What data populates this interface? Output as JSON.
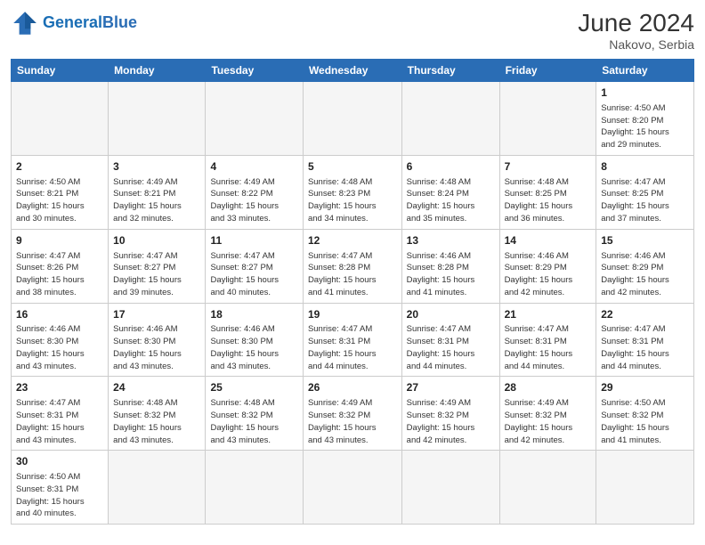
{
  "header": {
    "logo_general": "General",
    "logo_blue": "Blue",
    "month_year": "June 2024",
    "location": "Nakovo, Serbia"
  },
  "weekdays": [
    "Sunday",
    "Monday",
    "Tuesday",
    "Wednesday",
    "Thursday",
    "Friday",
    "Saturday"
  ],
  "weeks": [
    [
      {
        "day": "",
        "empty": true
      },
      {
        "day": "",
        "empty": true
      },
      {
        "day": "",
        "empty": true
      },
      {
        "day": "",
        "empty": true
      },
      {
        "day": "",
        "empty": true
      },
      {
        "day": "",
        "empty": true
      },
      {
        "day": "1",
        "info": "Sunrise: 4:50 AM\nSunset: 8:20 PM\nDaylight: 15 hours\nand 29 minutes."
      }
    ],
    [
      {
        "day": "2",
        "info": "Sunrise: 4:50 AM\nSunset: 8:21 PM\nDaylight: 15 hours\nand 30 minutes."
      },
      {
        "day": "3",
        "info": "Sunrise: 4:49 AM\nSunset: 8:21 PM\nDaylight: 15 hours\nand 32 minutes."
      },
      {
        "day": "4",
        "info": "Sunrise: 4:49 AM\nSunset: 8:22 PM\nDaylight: 15 hours\nand 33 minutes."
      },
      {
        "day": "5",
        "info": "Sunrise: 4:48 AM\nSunset: 8:23 PM\nDaylight: 15 hours\nand 34 minutes."
      },
      {
        "day": "6",
        "info": "Sunrise: 4:48 AM\nSunset: 8:24 PM\nDaylight: 15 hours\nand 35 minutes."
      },
      {
        "day": "7",
        "info": "Sunrise: 4:48 AM\nSunset: 8:25 PM\nDaylight: 15 hours\nand 36 minutes."
      },
      {
        "day": "8",
        "info": "Sunrise: 4:47 AM\nSunset: 8:25 PM\nDaylight: 15 hours\nand 37 minutes."
      }
    ],
    [
      {
        "day": "9",
        "info": "Sunrise: 4:47 AM\nSunset: 8:26 PM\nDaylight: 15 hours\nand 38 minutes."
      },
      {
        "day": "10",
        "info": "Sunrise: 4:47 AM\nSunset: 8:27 PM\nDaylight: 15 hours\nand 39 minutes."
      },
      {
        "day": "11",
        "info": "Sunrise: 4:47 AM\nSunset: 8:27 PM\nDaylight: 15 hours\nand 40 minutes."
      },
      {
        "day": "12",
        "info": "Sunrise: 4:47 AM\nSunset: 8:28 PM\nDaylight: 15 hours\nand 41 minutes."
      },
      {
        "day": "13",
        "info": "Sunrise: 4:46 AM\nSunset: 8:28 PM\nDaylight: 15 hours\nand 41 minutes."
      },
      {
        "day": "14",
        "info": "Sunrise: 4:46 AM\nSunset: 8:29 PM\nDaylight: 15 hours\nand 42 minutes."
      },
      {
        "day": "15",
        "info": "Sunrise: 4:46 AM\nSunset: 8:29 PM\nDaylight: 15 hours\nand 42 minutes."
      }
    ],
    [
      {
        "day": "16",
        "info": "Sunrise: 4:46 AM\nSunset: 8:30 PM\nDaylight: 15 hours\nand 43 minutes."
      },
      {
        "day": "17",
        "info": "Sunrise: 4:46 AM\nSunset: 8:30 PM\nDaylight: 15 hours\nand 43 minutes."
      },
      {
        "day": "18",
        "info": "Sunrise: 4:46 AM\nSunset: 8:30 PM\nDaylight: 15 hours\nand 43 minutes."
      },
      {
        "day": "19",
        "info": "Sunrise: 4:47 AM\nSunset: 8:31 PM\nDaylight: 15 hours\nand 44 minutes."
      },
      {
        "day": "20",
        "info": "Sunrise: 4:47 AM\nSunset: 8:31 PM\nDaylight: 15 hours\nand 44 minutes."
      },
      {
        "day": "21",
        "info": "Sunrise: 4:47 AM\nSunset: 8:31 PM\nDaylight: 15 hours\nand 44 minutes."
      },
      {
        "day": "22",
        "info": "Sunrise: 4:47 AM\nSunset: 8:31 PM\nDaylight: 15 hours\nand 44 minutes."
      }
    ],
    [
      {
        "day": "23",
        "info": "Sunrise: 4:47 AM\nSunset: 8:31 PM\nDaylight: 15 hours\nand 43 minutes."
      },
      {
        "day": "24",
        "info": "Sunrise: 4:48 AM\nSunset: 8:32 PM\nDaylight: 15 hours\nand 43 minutes."
      },
      {
        "day": "25",
        "info": "Sunrise: 4:48 AM\nSunset: 8:32 PM\nDaylight: 15 hours\nand 43 minutes."
      },
      {
        "day": "26",
        "info": "Sunrise: 4:49 AM\nSunset: 8:32 PM\nDaylight: 15 hours\nand 43 minutes."
      },
      {
        "day": "27",
        "info": "Sunrise: 4:49 AM\nSunset: 8:32 PM\nDaylight: 15 hours\nand 42 minutes."
      },
      {
        "day": "28",
        "info": "Sunrise: 4:49 AM\nSunset: 8:32 PM\nDaylight: 15 hours\nand 42 minutes."
      },
      {
        "day": "29",
        "info": "Sunrise: 4:50 AM\nSunset: 8:32 PM\nDaylight: 15 hours\nand 41 minutes."
      }
    ],
    [
      {
        "day": "30",
        "info": "Sunrise: 4:50 AM\nSunset: 8:31 PM\nDaylight: 15 hours\nand 40 minutes."
      },
      {
        "day": "",
        "empty": true
      },
      {
        "day": "",
        "empty": true
      },
      {
        "day": "",
        "empty": true
      },
      {
        "day": "",
        "empty": true
      },
      {
        "day": "",
        "empty": true
      },
      {
        "day": "",
        "empty": true
      }
    ]
  ]
}
